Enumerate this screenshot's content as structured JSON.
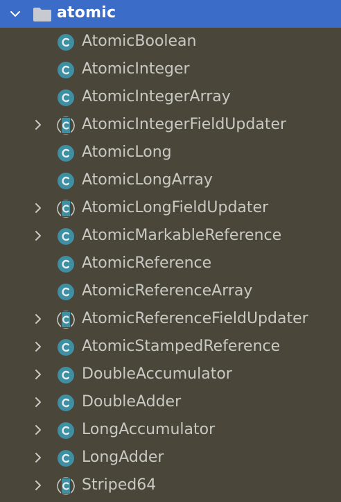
{
  "root": {
    "label": "atomic",
    "icon": "folder-icon",
    "expanded": true,
    "accent": "#3b6cc7"
  },
  "colors": {
    "background": "#4a4639",
    "class_icon": "#3f8fa3",
    "text": "#c9c9c4"
  },
  "items": [
    {
      "label": "AtomicBoolean",
      "expandable": false,
      "abstract": false
    },
    {
      "label": "AtomicInteger",
      "expandable": false,
      "abstract": false
    },
    {
      "label": "AtomicIntegerArray",
      "expandable": false,
      "abstract": false
    },
    {
      "label": "AtomicIntegerFieldUpdater",
      "expandable": true,
      "abstract": true
    },
    {
      "label": "AtomicLong",
      "expandable": false,
      "abstract": false
    },
    {
      "label": "AtomicLongArray",
      "expandable": false,
      "abstract": false
    },
    {
      "label": "AtomicLongFieldUpdater",
      "expandable": true,
      "abstract": true
    },
    {
      "label": "AtomicMarkableReference",
      "expandable": true,
      "abstract": false
    },
    {
      "label": "AtomicReference",
      "expandable": false,
      "abstract": false
    },
    {
      "label": "AtomicReferenceArray",
      "expandable": false,
      "abstract": false
    },
    {
      "label": "AtomicReferenceFieldUpdater",
      "expandable": true,
      "abstract": true
    },
    {
      "label": "AtomicStampedReference",
      "expandable": true,
      "abstract": false
    },
    {
      "label": "DoubleAccumulator",
      "expandable": true,
      "abstract": false
    },
    {
      "label": "DoubleAdder",
      "expandable": true,
      "abstract": false
    },
    {
      "label": "LongAccumulator",
      "expandable": true,
      "abstract": false
    },
    {
      "label": "LongAdder",
      "expandable": true,
      "abstract": false
    },
    {
      "label": "Striped64",
      "expandable": true,
      "abstract": true
    }
  ]
}
